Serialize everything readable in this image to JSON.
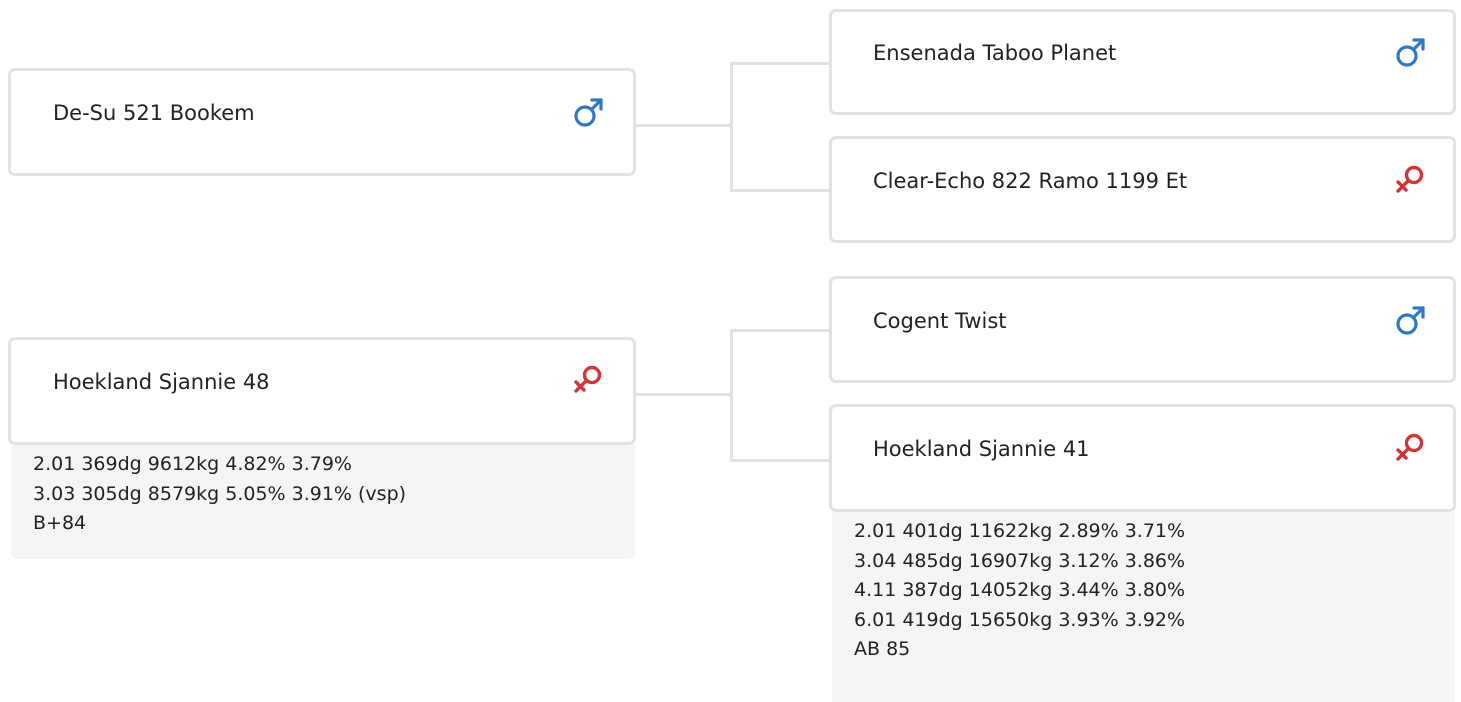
{
  "colors": {
    "male": "#2f78c4",
    "female": "#d0353a",
    "connector": "#e2e2e2",
    "card_border": "#e2e2e2",
    "info_background": "#f5f5f5"
  },
  "parents": [
    {
      "name": "De-Su 521 Bookem",
      "sex": "male",
      "icon": "male-symbol-icon"
    },
    {
      "name": "Hoekland Sjannie 48",
      "sex": "female",
      "icon": "female-symbol-icon",
      "records": [
        "2.01 369dg 9612kg 4.82% 3.79%",
        "3.03 305dg 8579kg 5.05% 3.91% (vsp)",
        "B+84"
      ]
    }
  ],
  "grandparents": [
    {
      "name": "Ensenada Taboo Planet",
      "sex": "male",
      "icon": "male-symbol-icon"
    },
    {
      "name": "Clear-Echo 822 Ramo 1199 Et",
      "sex": "female",
      "icon": "female-symbol-icon"
    },
    {
      "name": "Cogent Twist",
      "sex": "male",
      "icon": "male-symbol-icon"
    },
    {
      "name": "Hoekland Sjannie 41",
      "sex": "female",
      "icon": "female-symbol-icon",
      "records": [
        "2.01 401dg 11622kg 2.89% 3.71%",
        "3.04 485dg 16907kg 3.12% 3.86%",
        "4.11 387dg 14052kg 3.44% 3.80%",
        "6.01 419dg 15650kg 3.93% 3.92%",
        "AB 85"
      ]
    }
  ]
}
